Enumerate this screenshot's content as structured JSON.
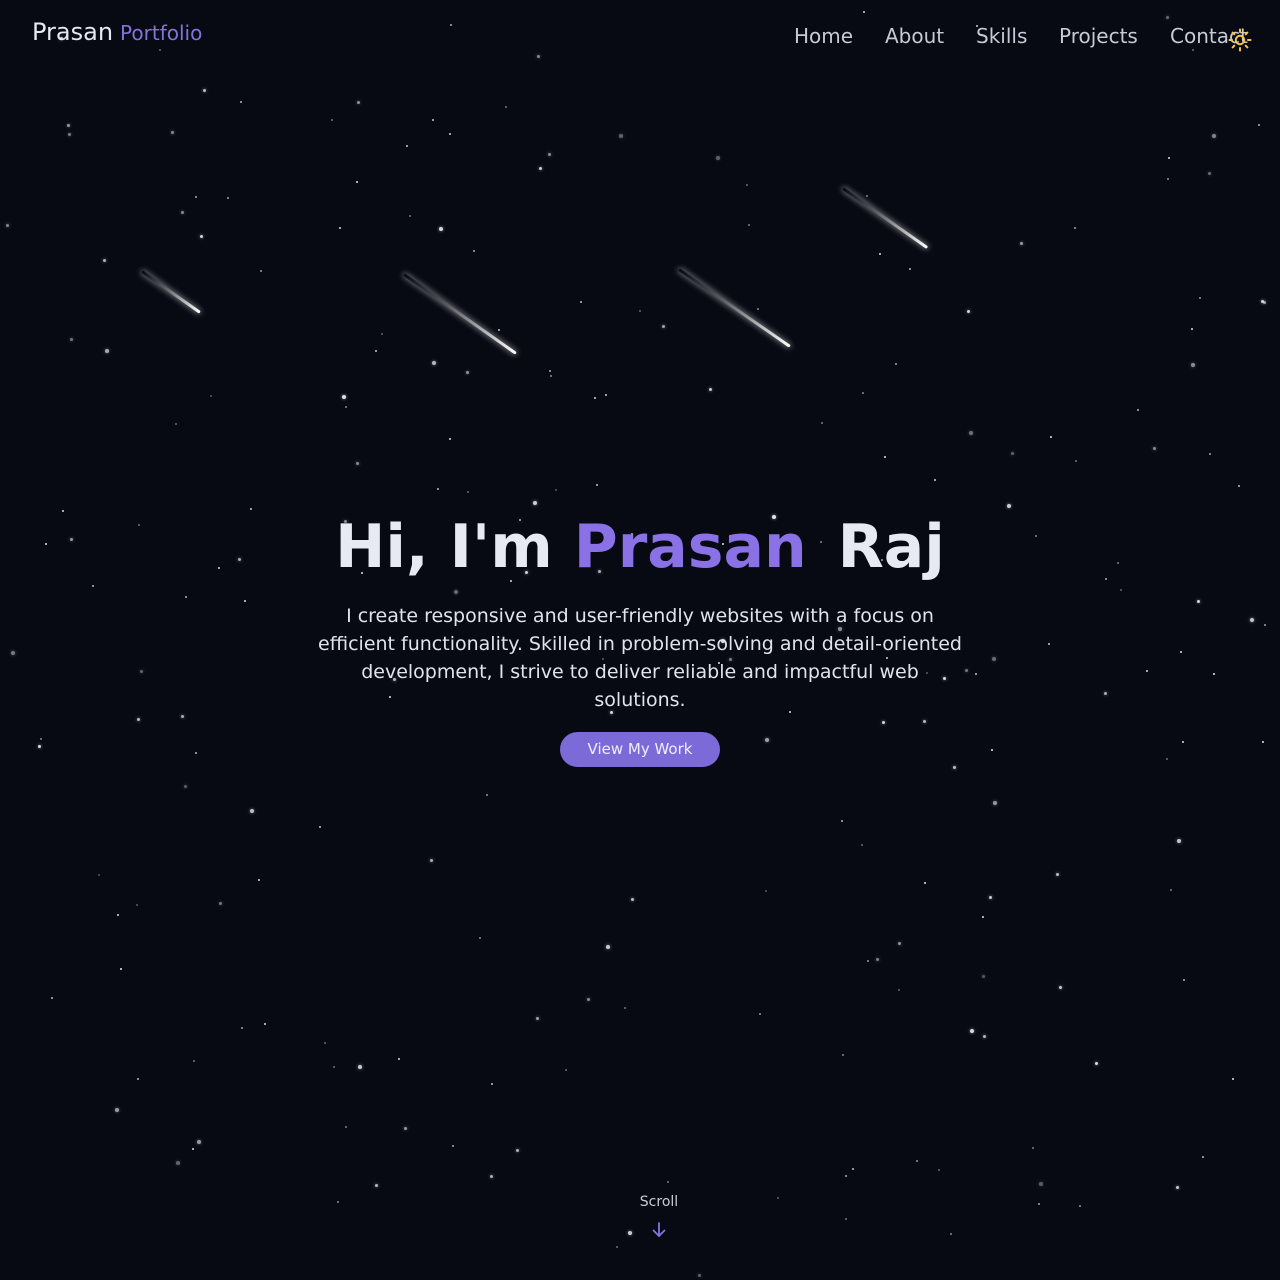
{
  "header": {
    "brand_name": "Prasan",
    "brand_tag": "Portfolio",
    "nav": [
      {
        "label": "Home"
      },
      {
        "label": "About"
      },
      {
        "label": "Skills"
      },
      {
        "label": "Projects"
      },
      {
        "label": "Contact"
      }
    ],
    "theme_toggle_icon": "sun-icon"
  },
  "hero": {
    "greeting": "Hi, I'm",
    "first_name": "Prasan",
    "last_name": "Raj",
    "description": "I create responsive and user-friendly websites with a focus on efficient functionality. Skilled in problem-solving and detail-oriented development, I strive to deliver reliable and impactful web solutions.",
    "cta_label": "View My Work"
  },
  "scroll": {
    "label": "Scroll",
    "icon": "arrow-down-icon"
  },
  "colors": {
    "background": "#070a13",
    "accent": "#8a72e6",
    "button": "#7c6ad9",
    "sun": "#f5c542"
  }
}
